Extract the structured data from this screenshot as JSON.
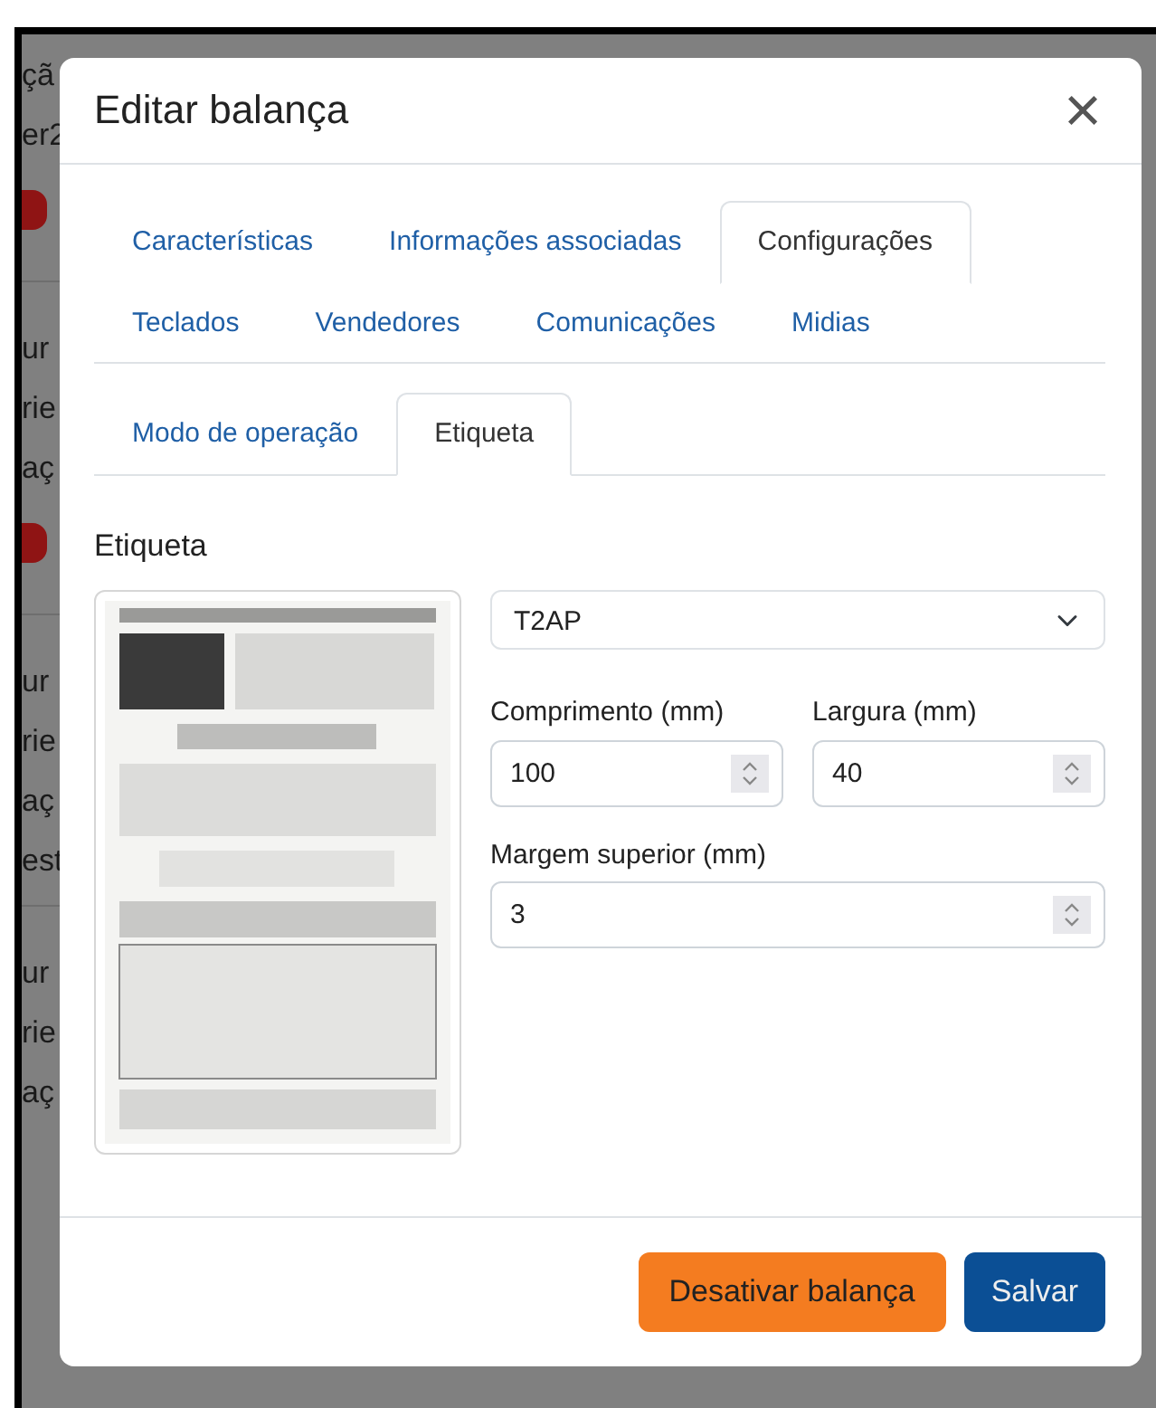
{
  "background": {
    "rows": [
      {
        "kind": "text",
        "text": "çã"
      },
      {
        "kind": "text",
        "text": "er2"
      },
      {
        "kind": "badge"
      },
      {
        "kind": "divider"
      },
      {
        "kind": "text",
        "text": "ur"
      },
      {
        "kind": "text",
        "text": "rie"
      },
      {
        "kind": "text",
        "text": "aç"
      },
      {
        "kind": "badge"
      },
      {
        "kind": "divider"
      },
      {
        "kind": "text",
        "text": "ur"
      },
      {
        "kind": "text",
        "text": "rie"
      },
      {
        "kind": "text",
        "text": "aç"
      },
      {
        "kind": "text",
        "text": "est"
      },
      {
        "kind": "divider"
      },
      {
        "kind": "text",
        "text": "ur"
      },
      {
        "kind": "text",
        "text": "rie"
      },
      {
        "kind": "text",
        "text": "aç"
      }
    ]
  },
  "modal": {
    "title": "Editar balança",
    "close": "×",
    "tabs": [
      {
        "label": "Características",
        "selected": false
      },
      {
        "label": "Informações associadas",
        "selected": false
      },
      {
        "label": "Configurações",
        "selected": true
      },
      {
        "label": "Teclados",
        "selected": false
      },
      {
        "label": "Vendedores",
        "selected": false
      },
      {
        "label": "Comunicações",
        "selected": false
      },
      {
        "label": "Midias",
        "selected": false
      }
    ],
    "subtabs": [
      {
        "label": "Modo de operação",
        "selected": false
      },
      {
        "label": "Etiqueta",
        "selected": true
      }
    ],
    "section_title": "Etiqueta",
    "label_select": {
      "value": "T2AP"
    },
    "fields": [
      {
        "label": "Comprimento (mm)",
        "value": "100"
      },
      {
        "label": "Largura (mm)",
        "value": "40"
      },
      {
        "label": "Margem superior (mm)",
        "value": "3"
      }
    ],
    "buttons": [
      {
        "label": "Desativar balança",
        "kind": "warning"
      },
      {
        "label": "Salvar",
        "kind": "primary"
      }
    ]
  }
}
